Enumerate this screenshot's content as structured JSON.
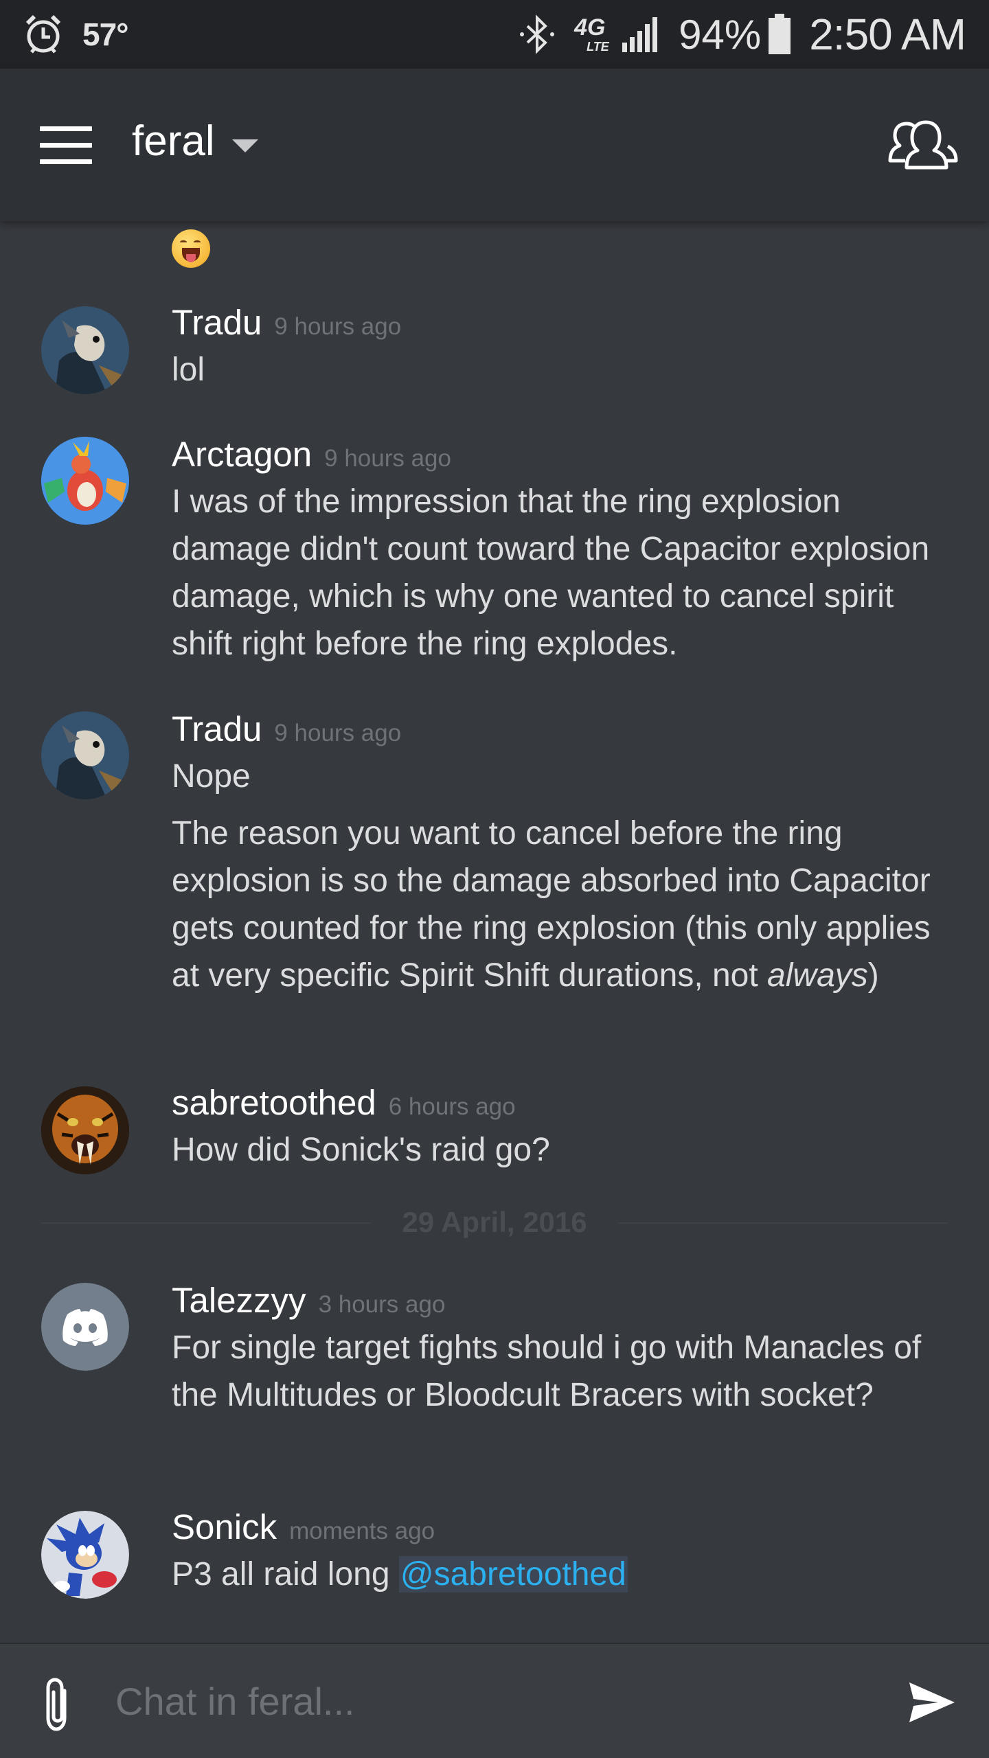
{
  "status_bar": {
    "temperature": "57°",
    "battery": "94%",
    "time": "2:50 AM",
    "network_gen": "4G",
    "network_type": "LTE"
  },
  "header": {
    "channel": "feral"
  },
  "messages": [
    {
      "user": "Tradu",
      "time": "9 hours ago",
      "lines": [
        "lol"
      ]
    },
    {
      "user": "Arctagon",
      "time": "9 hours ago",
      "lines": [
        "I was of the impression that the ring explosion damage didn't count toward the Capacitor explosion damage, which is why one wanted to cancel spirit shift right before the ring explodes."
      ]
    },
    {
      "user": "Tradu",
      "time": "9 hours ago",
      "lines": [
        "Nope",
        "The reason you want to cancel before the ring explosion is so the damage absorbed into Capacitor gets counted for the ring explosion (this only applies at very specific Spirit Shift durations, not ",
        "always",
        ")"
      ]
    },
    {
      "user": "sabretoothed",
      "time": "6 hours ago",
      "lines": [
        "How did Sonick's raid go?"
      ]
    },
    {
      "user": "Talezzyy",
      "time": "3 hours ago",
      "lines": [
        "For single target fights should i go with Manacles of the Multitudes or Bloodcult Bracers with socket?"
      ]
    },
    {
      "user": "Sonick",
      "time": "moments ago",
      "lines": [
        "P3 all raid long ",
        "@sabretoothed"
      ]
    }
  ],
  "date_divider": "29 April, 2016",
  "composer": {
    "placeholder": "Chat in feral..."
  },
  "colors": {
    "background": "#36393e",
    "header": "#2e3136",
    "status_bar": "#222327",
    "mention": "#2bb0f0"
  }
}
